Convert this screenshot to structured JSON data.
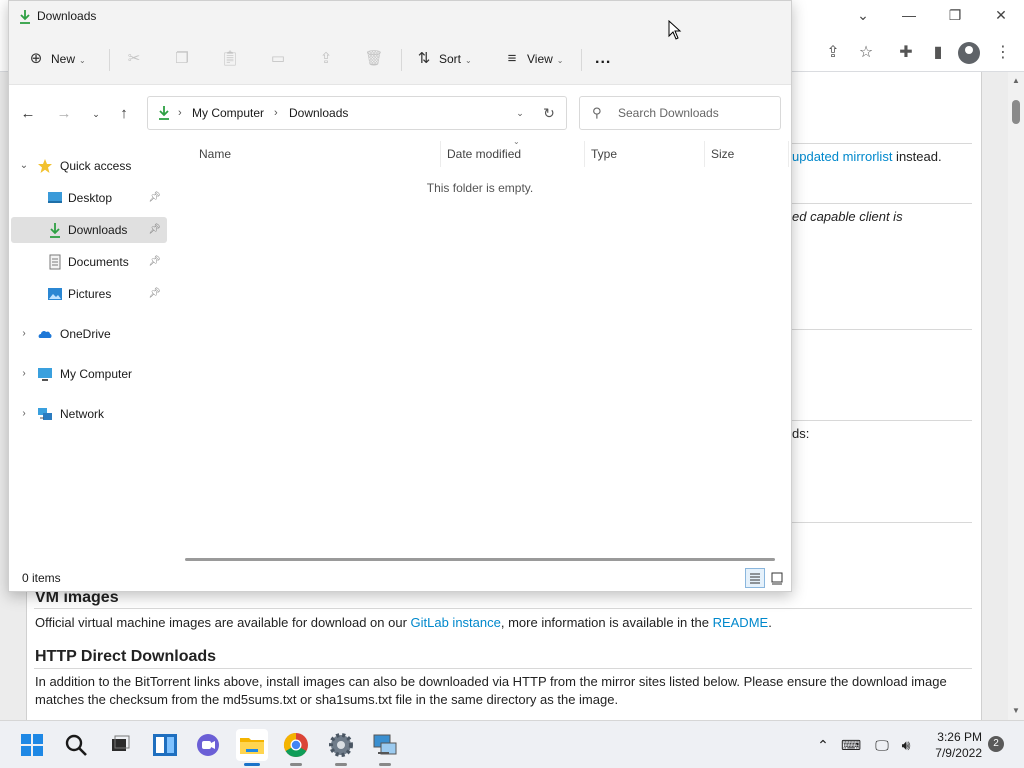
{
  "explorer": {
    "title": "Downloads",
    "toolbar": {
      "new_label": "New",
      "sort_label": "Sort",
      "view_label": "View",
      "more_label": "..."
    },
    "address": {
      "segments": [
        "My Computer",
        "Downloads"
      ]
    },
    "search": {
      "placeholder": "Search Downloads"
    },
    "nav": {
      "quick_access": "Quick access",
      "pinned": [
        "Desktop",
        "Downloads",
        "Documents",
        "Pictures"
      ],
      "onedrive": "OneDrive",
      "my_computer": "My Computer",
      "network": "Network",
      "selected": "Downloads"
    },
    "columns": [
      "Name",
      "Date modified",
      "Type",
      "Size"
    ],
    "empty_message": "This folder is empty.",
    "status": {
      "items": "0 items"
    }
  },
  "webpage": {
    "frag_mirror": "updated mirrorlist",
    "frag_instead": " instead.",
    "frag_client": "ed capable client is",
    "frag_ds": "ds:",
    "vm_heading": "VM images",
    "vm_text_1": "Official virtual machine images are available for download on our ",
    "vm_link_gitlab": "GitLab instance",
    "vm_text_2": ", more information is available in the ",
    "vm_link_readme": "README",
    "vm_text_3": ".",
    "http_heading": "HTTP Direct Downloads",
    "http_line_1": "In addition to the BitTorrent links above, install images can also be downloaded via HTTP from the mirror sites listed below. Please ensure the download image",
    "http_line_2": "matches the checksum from the md5sums.txt or sha1sums.txt file in the same directory as the image."
  },
  "taskbar": {
    "time": "3:26 PM",
    "date": "7/9/2022",
    "notification_count": "2",
    "apps": [
      "start-icon",
      "search-icon",
      "task-view-icon",
      "widgets-icon",
      "chat-icon",
      "file-explorer-icon",
      "chrome-icon",
      "settings-icon",
      "network-computer-icon"
    ]
  },
  "colors": {
    "accent": "#1a73c9",
    "link": "#0088cc",
    "download_green": "#2ea043"
  }
}
